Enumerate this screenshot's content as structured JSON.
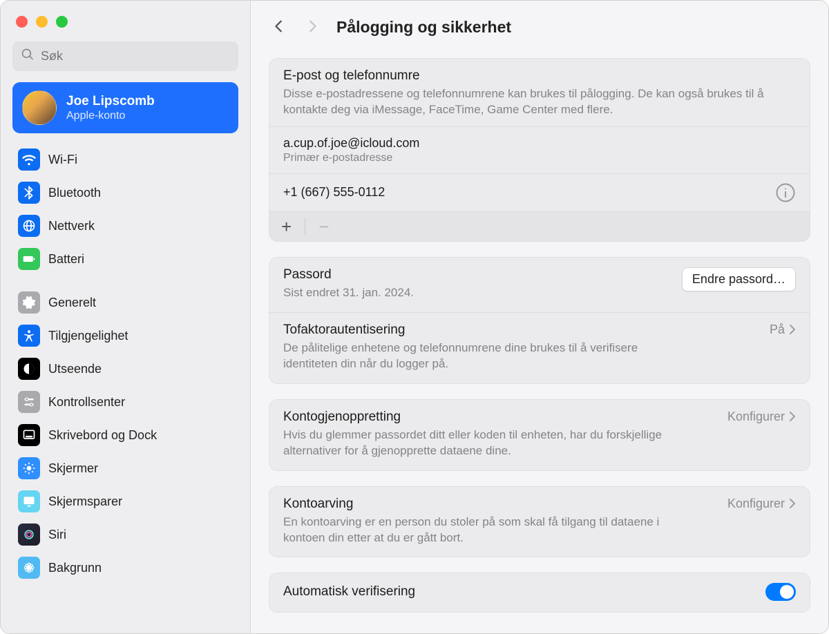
{
  "search": {
    "placeholder": "Søk"
  },
  "account": {
    "name": "Joe Lipscomb",
    "sub": "Apple-konto"
  },
  "sidebar": {
    "items": [
      {
        "label": "Wi-Fi",
        "icon": "wifi",
        "bg": "#0c6cf2"
      },
      {
        "label": "Bluetooth",
        "icon": "bluetooth",
        "bg": "#0c6cf2"
      },
      {
        "label": "Nettverk",
        "icon": "globe",
        "bg": "#0c6cf2"
      },
      {
        "label": "Batteri",
        "icon": "battery",
        "bg": "#34c759"
      }
    ],
    "items2": [
      {
        "label": "Generelt",
        "icon": "gear",
        "bg": "#a9a9ae"
      },
      {
        "label": "Tilgjengelighet",
        "icon": "person",
        "bg": "#0c6cf2"
      },
      {
        "label": "Utseende",
        "icon": "contrast",
        "bg": "#000000"
      },
      {
        "label": "Kontrollsenter",
        "icon": "sliders",
        "bg": "#a9a9ae"
      },
      {
        "label": "Skrivebord og Dock",
        "icon": "dock",
        "bg": "#000000"
      },
      {
        "label": "Skjermer",
        "icon": "brightness",
        "bg": "#2f8fff"
      },
      {
        "label": "Skjermsparer",
        "icon": "screensaver",
        "bg": "#65d5f2"
      },
      {
        "label": "Siri",
        "icon": "siri",
        "bg": "#222222"
      },
      {
        "label": "Bakgrunn",
        "icon": "wallpaper",
        "bg": "#52baf2"
      }
    ]
  },
  "header": {
    "title": "Pålogging og sikkerhet"
  },
  "email_section": {
    "title": "E-post og telefonnumre",
    "desc": "Disse e-postadressene og telefonnumrene kan brukes til pålogging. De kan også brukes til å kontakte deg via iMessage, FaceTime, Game Center med flere.",
    "email": "a.cup.of.joe@icloud.com",
    "email_sub": "Primær e-postadresse",
    "phone": "+1 (667) 555-0112"
  },
  "password": {
    "title": "Passord",
    "desc": "Sist endret 31. jan. 2024.",
    "button": "Endre passord…"
  },
  "twofactor": {
    "title": "Tofaktorautentisering",
    "desc": "De pålitelige enhetene og telefonnumrene dine brukes til å verifisere identiteten din når du logger på.",
    "status": "På"
  },
  "recovery": {
    "title": "Kontogjenoppretting",
    "desc": "Hvis du glemmer passordet ditt eller koden til enheten, har du forskjellige alternativer for å gjenopprette dataene dine.",
    "action": "Konfigurer"
  },
  "legacy": {
    "title": "Kontoarving",
    "desc": "En kontoarving er en person du stoler på som skal få tilgang til dataene i kontoen din etter at du er gått bort.",
    "action": "Konfigurer"
  },
  "autoverify": {
    "title": "Automatisk verifisering"
  },
  "icons": {
    "plus": "+",
    "minus": "−"
  }
}
